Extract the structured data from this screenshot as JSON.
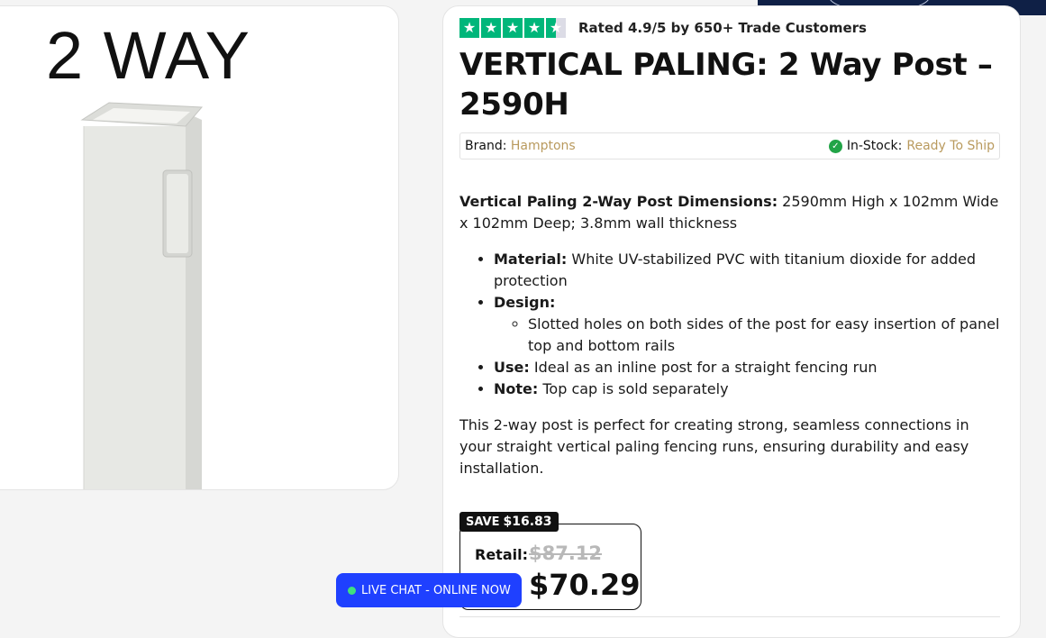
{
  "image": {
    "caption": "2 WAY",
    "post_color": "#e7e8e4"
  },
  "rating": {
    "stars": 4.5,
    "star_glyph": "★",
    "text": "Rated 4.9/5 by 650+ Trade Customers"
  },
  "product": {
    "title": "VERTICAL PALING: 2 Way Post – 2590H",
    "brand_label": "Brand:",
    "brand_value": "Hamptons",
    "stock_label": "In-Stock:",
    "stock_value": "Ready To Ship"
  },
  "description": {
    "intro_bold": "Vertical Paling 2-Way Post Dimensions:",
    "intro_text": " 2590mm High x 102mm Wide x 102mm Deep; 3.8mm wall thickness",
    "bullets": [
      {
        "label": "Material:",
        "text": " White UV-stabilized PVC with titanium dioxide for added protection"
      },
      {
        "label": "Design:",
        "text": ""
      },
      {
        "label": "Use:",
        "text": " Ideal as an inline post for a straight fencing run"
      },
      {
        "label": "Note:",
        "text": " Top cap is sold separately"
      }
    ],
    "design_sub": "Slotted holes on both sides of the post for easy insertion of panel top and bottom rails",
    "closing": "This 2-way post is perfect for creating strong, seamless connections in your straight vertical paling fencing runs, ensuring durability and easy installation."
  },
  "pricing": {
    "save_label": "SAVE",
    "save_amount": "$16.83",
    "retail_label": "Retail:",
    "retail_price": "$87.12",
    "sale_price": "$70.29"
  },
  "chat": {
    "label": "LIVE CHAT - ONLINE NOW"
  },
  "colors": {
    "accent_gold": "#b99a5e",
    "trustpilot_green": "#00b67a",
    "chat_blue": "#1f40ff",
    "header_navy": "#0f2046"
  }
}
